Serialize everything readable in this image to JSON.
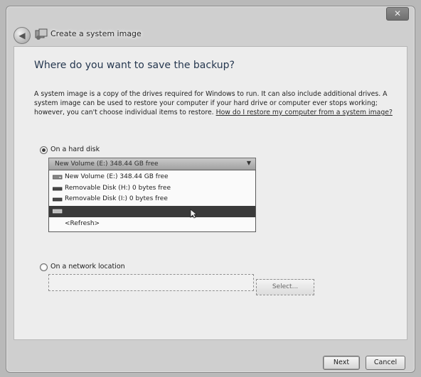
{
  "window": {
    "title": "Create a system image",
    "close_label": "✕",
    "back_label": "◀"
  },
  "main": {
    "heading": "Where do you want to save the backup?",
    "description": "A system image is a copy of the drives required for Windows to run. It can also include additional drives. A system image can be used to restore your computer if your hard drive or computer ever stops working; however, you can't choose individual items to restore.",
    "help_link": "How do I restore my computer from a system image?"
  },
  "hard_disk": {
    "label": "On a hard disk",
    "selected": true,
    "dropdown_value": "New Volume (E:)  348.44 GB free",
    "options": [
      {
        "label": "New Volume (E:)  348.44 GB free",
        "icon": "hard-drive-icon"
      },
      {
        "label": "Removable Disk (H:)  0 bytes free",
        "icon": "removable-disk-icon"
      },
      {
        "label": "Removable Disk (I:)  0 bytes free",
        "icon": "removable-disk-icon"
      },
      {
        "label": "",
        "icon": "drive-icon"
      },
      {
        "label": "<Refresh>",
        "icon": ""
      }
    ],
    "highlighted_option": 3
  },
  "network": {
    "label": "On a network location",
    "selected": false,
    "input_value": "",
    "select_button": "Select..."
  },
  "footer": {
    "next_label": "Next",
    "cancel_label": "Cancel"
  }
}
